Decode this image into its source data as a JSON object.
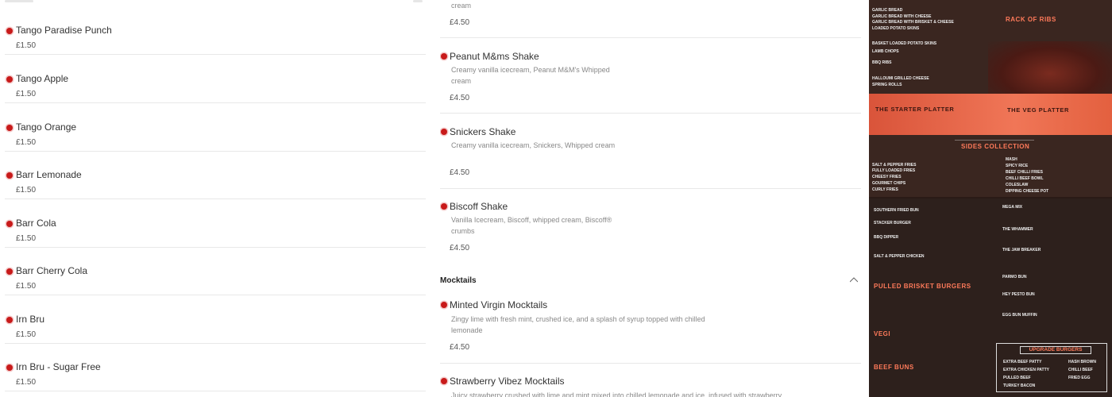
{
  "left_items": [
    {
      "name": "Tango Paradise Punch",
      "price": "£1.50"
    },
    {
      "name": "Tango Apple",
      "price": "£1.50"
    },
    {
      "name": "Tango Orange",
      "price": "£1.50"
    },
    {
      "name": "Barr Lemonade",
      "price": "£1.50"
    },
    {
      "name": "Barr Cola",
      "price": "£1.50"
    },
    {
      "name": "Barr Cherry Cola",
      "price": "£1.50"
    },
    {
      "name": "Irn Bru",
      "price": "£1.50"
    },
    {
      "name": "Irn Bru - Sugar Free",
      "price": "£1.50"
    }
  ],
  "mid_items": {
    "partial_top": {
      "desc_tail": "cream",
      "price": "£4.50"
    },
    "peanut": {
      "name": "Peanut M&ms Shake",
      "desc": "Creamy vanilla icecream, Peanut M&M's Whipped cream",
      "price": "£4.50"
    },
    "snickers": {
      "name": "Snickers Shake",
      "desc": "Creamy vanilla icecream, Snickers, Whipped cream",
      "price": "£4.50"
    },
    "biscoff": {
      "name": "Biscoff Shake",
      "desc": "Vanilla Icecream, Biscoff, whipped cream, Biscoff® crumbs",
      "price": "£4.50"
    },
    "mocktails_heading": "Mocktails",
    "minted": {
      "name": "Minted Virgin Mocktails",
      "desc": "Zingy lime with fresh mint, crushed ice, and a splash of syrup topped with chilled lemonade",
      "price": "£4.50"
    },
    "strawberry": {
      "name": "Strawberry Vibez Mocktails",
      "desc": "Juicy strawberry crushed with lime and mint mixed into chilled lemonade and ice, infused with strawberry"
    }
  },
  "menu_photo": {
    "rack_title": "RACK OF RIBS",
    "starter_platter": "THE STARTER PLATTER",
    "veg_platter": "THE VEG PLATTER",
    "sides_title": "SIDES COLLECTION",
    "pulled_title": "PULLED BRISKET BURGERS",
    "vegi_title": "VEGI",
    "beef_buns": "BEEF BUNS",
    "upgrade_title": "UPGRADE BURGERS",
    "sides_left": [
      "SALT & PEPPER FRIES",
      "FULLY LOADED FRIES",
      "CHEESY FRIES",
      "GOURMET CHIPS",
      "CURLY FRIES"
    ],
    "sides_right": [
      "MASH",
      "SPICY RICE",
      "BEEF CHILLI FRIES",
      "CHILLI BEEF BOWL",
      "COLESLAW",
      "DIPPING CHEESE POT"
    ],
    "bot_left": [
      "SOUTHERN FRIED BUN",
      "STACKER BURGER",
      "BBQ DIPPER",
      "SALT & PEPPER CHICKEN"
    ],
    "bot_right": [
      "MEGA MIX",
      "THE WHAMMER",
      "THE JAW BREAKER",
      "PARMO BUN",
      "HEY PESTO BUN",
      "EGG BUN MUFFIN"
    ],
    "top_left": [
      "GARLIC BREAD",
      "GARLIC BREAD WITH CHEESE",
      "GARLIC BREAD WITH BRISKET & CHEESE",
      "LOADED POTATO SKINS",
      "BASKET LOADED POTATO SKINS",
      "LAMB CHOPS",
      "BBQ RIBS",
      "HALLOUMI GRILLED CHEESE",
      "SPRING ROLLS"
    ],
    "upgrade_rows": [
      "EXTRA BEEF PATTY",
      "EXTRA CHICKEN PATTY",
      "PULLED BEEF",
      "TURKEY BACON"
    ],
    "upgrade_rows_right": [
      "HASH BROWN",
      "CHILLI BEEF",
      "FRIED EGG"
    ]
  }
}
